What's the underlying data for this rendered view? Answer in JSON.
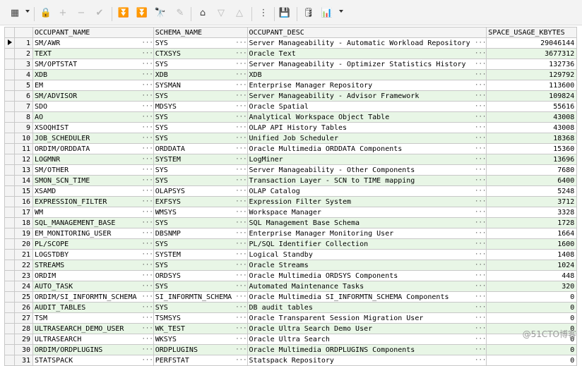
{
  "columns": [
    "OCCUPANT_NAME",
    "SCHEMA_NAME",
    "OCCUPANT_DESC",
    "SPACE_USAGE_KBYTES"
  ],
  "current_row": 1,
  "rows": [
    {
      "n": "1",
      "occupant_name": "SM/AWR",
      "schema_name": "SYS",
      "occupant_desc": "Server Manageability - Automatic Workload Repository",
      "space_usage_kbytes": "29046144"
    },
    {
      "n": "2",
      "occupant_name": "TEXT",
      "schema_name": "CTXSYS",
      "occupant_desc": "Oracle Text",
      "space_usage_kbytes": "3677312"
    },
    {
      "n": "3",
      "occupant_name": "SM/OPTSTAT",
      "schema_name": "SYS",
      "occupant_desc": "Server Manageability - Optimizer Statistics History",
      "space_usage_kbytes": "132736"
    },
    {
      "n": "4",
      "occupant_name": "XDB",
      "schema_name": "XDB",
      "occupant_desc": "XDB",
      "space_usage_kbytes": "129792"
    },
    {
      "n": "5",
      "occupant_name": "EM",
      "schema_name": "SYSMAN",
      "occupant_desc": "Enterprise Manager Repository",
      "space_usage_kbytes": "113600"
    },
    {
      "n": "6",
      "occupant_name": "SM/ADVISOR",
      "schema_name": "SYS",
      "occupant_desc": "Server Manageability - Advisor Framework",
      "space_usage_kbytes": "109824"
    },
    {
      "n": "7",
      "occupant_name": "SDO",
      "schema_name": "MDSYS",
      "occupant_desc": "Oracle Spatial",
      "space_usage_kbytes": "55616"
    },
    {
      "n": "8",
      "occupant_name": "AO",
      "schema_name": "SYS",
      "occupant_desc": "Analytical Workspace Object Table",
      "space_usage_kbytes": "43008"
    },
    {
      "n": "9",
      "occupant_name": "XSOQHIST",
      "schema_name": "SYS",
      "occupant_desc": "OLAP API History Tables",
      "space_usage_kbytes": "43008"
    },
    {
      "n": "10",
      "occupant_name": "JOB_SCHEDULER",
      "schema_name": "SYS",
      "occupant_desc": "Unified Job Scheduler",
      "space_usage_kbytes": "18368"
    },
    {
      "n": "11",
      "occupant_name": "ORDIM/ORDDATA",
      "schema_name": "ORDDATA",
      "occupant_desc": "Oracle Multimedia ORDDATA Components",
      "space_usage_kbytes": "15360"
    },
    {
      "n": "12",
      "occupant_name": "LOGMNR",
      "schema_name": "SYSTEM",
      "occupant_desc": "LogMiner",
      "space_usage_kbytes": "13696"
    },
    {
      "n": "13",
      "occupant_name": "SM/OTHER",
      "schema_name": "SYS",
      "occupant_desc": "Server Manageability - Other Components",
      "space_usage_kbytes": "7680"
    },
    {
      "n": "14",
      "occupant_name": "SMON_SCN_TIME",
      "schema_name": "SYS",
      "occupant_desc": "Transaction Layer - SCN to TIME mapping",
      "space_usage_kbytes": "6400"
    },
    {
      "n": "15",
      "occupant_name": "XSAMD",
      "schema_name": "OLAPSYS",
      "occupant_desc": "OLAP Catalog",
      "space_usage_kbytes": "5248"
    },
    {
      "n": "16",
      "occupant_name": "EXPRESSION_FILTER",
      "schema_name": "EXFSYS",
      "occupant_desc": "Expression Filter System",
      "space_usage_kbytes": "3712"
    },
    {
      "n": "17",
      "occupant_name": "WM",
      "schema_name": "WMSYS",
      "occupant_desc": "Workspace Manager",
      "space_usage_kbytes": "3328"
    },
    {
      "n": "18",
      "occupant_name": "SQL_MANAGEMENT_BASE",
      "schema_name": "SYS",
      "occupant_desc": "SQL Management Base Schema",
      "space_usage_kbytes": "1728"
    },
    {
      "n": "19",
      "occupant_name": "EM_MONITORING_USER",
      "schema_name": "DBSNMP",
      "occupant_desc": "Enterprise Manager Monitoring User",
      "space_usage_kbytes": "1664"
    },
    {
      "n": "20",
      "occupant_name": "PL/SCOPE",
      "schema_name": "SYS",
      "occupant_desc": "PL/SQL Identifier Collection",
      "space_usage_kbytes": "1600"
    },
    {
      "n": "21",
      "occupant_name": "LOGSTDBY",
      "schema_name": "SYSTEM",
      "occupant_desc": "Logical Standby",
      "space_usage_kbytes": "1408"
    },
    {
      "n": "22",
      "occupant_name": "STREAMS",
      "schema_name": "SYS",
      "occupant_desc": "Oracle Streams",
      "space_usage_kbytes": "1024"
    },
    {
      "n": "23",
      "occupant_name": "ORDIM",
      "schema_name": "ORDSYS",
      "occupant_desc": "Oracle Multimedia ORDSYS Components",
      "space_usage_kbytes": "448"
    },
    {
      "n": "24",
      "occupant_name": "AUTO_TASK",
      "schema_name": "SYS",
      "occupant_desc": "Automated Maintenance Tasks",
      "space_usage_kbytes": "320"
    },
    {
      "n": "25",
      "occupant_name": "ORDIM/SI_INFORMTN_SCHEMA",
      "schema_name": "SI_INFORMTN_SCHEMA",
      "occupant_desc": "Oracle Multimedia SI_INFORMTN_SCHEMA Components",
      "space_usage_kbytes": "0"
    },
    {
      "n": "26",
      "occupant_name": "AUDIT_TABLES",
      "schema_name": "SYS",
      "occupant_desc": "DB audit tables",
      "space_usage_kbytes": "0"
    },
    {
      "n": "27",
      "occupant_name": "TSM",
      "schema_name": "TSMSYS",
      "occupant_desc": "Oracle Transparent Session Migration User",
      "space_usage_kbytes": "0"
    },
    {
      "n": "28",
      "occupant_name": "ULTRASEARCH_DEMO_USER",
      "schema_name": "WK_TEST",
      "occupant_desc": "Oracle Ultra Search Demo User",
      "space_usage_kbytes": "0"
    },
    {
      "n": "29",
      "occupant_name": "ULTRASEARCH",
      "schema_name": "WKSYS",
      "occupant_desc": "Oracle Ultra Search",
      "space_usage_kbytes": "0"
    },
    {
      "n": "30",
      "occupant_name": "ORDIM/ORDPLUGINS",
      "schema_name": "ORDPLUGINS",
      "occupant_desc": "Oracle Multimedia ORDPLUGINS Components",
      "space_usage_kbytes": "0"
    },
    {
      "n": "31",
      "occupant_name": "STATSPACK",
      "schema_name": "PERFSTAT",
      "occupant_desc": "Statspack Repository",
      "space_usage_kbytes": "0"
    }
  ],
  "ellipsis": "···",
  "watermark": "@51CTO博客",
  "icons": {
    "grid": "▦",
    "lock": "🔒",
    "add": "+",
    "remove": "−",
    "post": "✔",
    "first": "⏬",
    "last": "⏬",
    "find": "🔭",
    "clear": "✎",
    "query": "⌂",
    "next": "▽",
    "prev": "△",
    "tree": "⋮",
    "save": "💾",
    "db": "🛢",
    "chart": "📊"
  },
  "colors": {
    "alt_row": "#e8f6e6",
    "header_bg": "#f4f4f4"
  }
}
